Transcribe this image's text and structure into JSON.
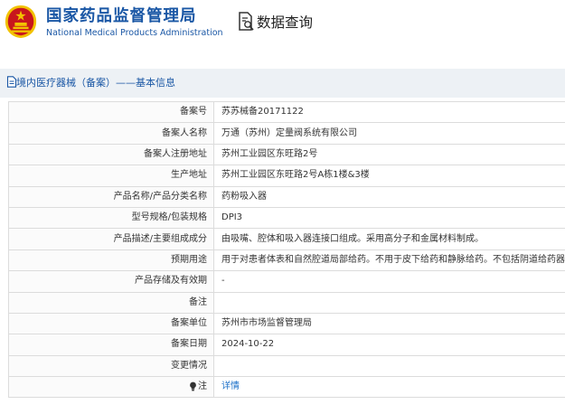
{
  "header": {
    "org_name_cn": "国家药品监督管理局",
    "org_name_en": "National Medical Products Administration",
    "page_title": "数据查询",
    "emblem_icon": "national-emblem-icon",
    "query_icon": "document-search-icon"
  },
  "breadcrumb": {
    "icon": "document-icon",
    "text": "境内医疗器械（备案）——基本信息"
  },
  "details": [
    {
      "label": "备案号",
      "value": "苏苏械备20171122"
    },
    {
      "label": "备案人名称",
      "value": "万通（苏州）定量阀系统有限公司"
    },
    {
      "label": "备案人注册地址",
      "value": "苏州工业园区东旺路2号"
    },
    {
      "label": "生产地址",
      "value": "苏州工业园区东旺路2号A栋1楼&3楼"
    },
    {
      "label": "产品名称/产品分类名称",
      "value": "药粉吸入器"
    },
    {
      "label": "型号规格/包装规格",
      "value": "DPI3"
    },
    {
      "label": "产品描述/主要组成成分",
      "value": "由吸嘴、腔体和吸入器连接口组成。采用高分子和金属材料制成。"
    },
    {
      "label": "预期用途",
      "value": "用于对患者体表和自然腔道局部给药。不用于皮下给药和静脉给药。不包括阴道给药器。"
    },
    {
      "label": "产品存储及有效期",
      "value": "-"
    },
    {
      "label": "备注",
      "value": ""
    },
    {
      "label": "备案单位",
      "value": "苏州市市场监督管理局"
    },
    {
      "label": "备案日期",
      "value": "2024-10-22"
    },
    {
      "label": "变更情况",
      "value": ""
    }
  ],
  "detail_link": {
    "icon": "lightbulb-icon",
    "label": "注",
    "text": "详情"
  },
  "colors": {
    "brand_blue": "#1a57a5",
    "emblem_red": "#c8161d",
    "emblem_gold": "#f2c200",
    "band_bg": "#edf1f5",
    "link": "#1a6fc8",
    "border": "#dcdcdc"
  }
}
